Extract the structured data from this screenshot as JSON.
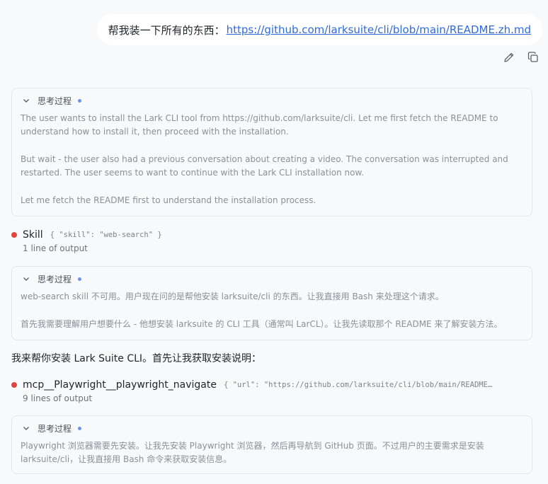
{
  "user_message": {
    "prefix": "帮我装一下所有的东西：",
    "link": "https://github.com/larksuite/cli/blob/main/README.zh.md"
  },
  "message_actions": [
    {
      "icon": "pencil-icon"
    },
    {
      "icon": "copy-icon"
    }
  ],
  "thinking_label": "思考过程",
  "thinking_blocks": [
    {
      "paragraphs": [
        "The user wants to install the Lark CLI tool from https://github.com/larksuite/cli. Let me first fetch the README to understand how to install it, then proceed with the installation.",
        "But wait - the user also had a previous conversation about creating a video. The conversation was interrupted and restarted. The user seems to want to continue with the Lark CLI installation now.",
        "Let me fetch the README first to understand the installation process."
      ]
    },
    {
      "paragraphs": [
        "web-search skill 不可用。用户现在问的是帮他安装 larksuite/cli 的东西。让我直接用 Bash 来处理这个请求。",
        "首先我需要理解用户想要什么 - 他想安装 larksuite 的 CLI 工具（通常叫 LarCL）。让我先读取那个 README 来了解安装方法。"
      ]
    },
    {
      "paragraphs": [
        "Playwright 浏览器需要先安装。让我先安装 Playwright 浏览器，然后再导航到 GitHub 页面。不过用户的主要需求是安装 larksuite/cli，让我直接用 Bash 命令来获取安装信息。"
      ]
    }
  ],
  "tool_calls": [
    {
      "name": "Skill",
      "args": "{ \"skill\": \"web-search\" }",
      "summary": "1 line of output"
    },
    {
      "name": "mcp__Playwright__playwright_navigate",
      "args": "{ \"url\": \"https://github.com/larksuite/cli/blob/main/README…",
      "summary": "9 lines of output"
    }
  ],
  "assistant_text": "我来帮你安装 Lark Suite CLI。首先让我获取安装说明："
}
